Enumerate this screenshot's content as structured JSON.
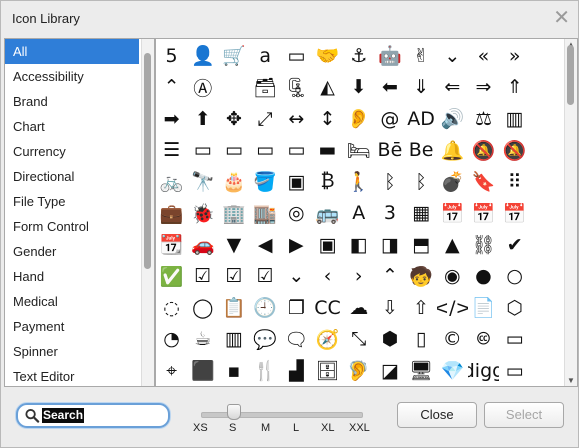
{
  "window": {
    "title": "Icon Library",
    "close_symbol": "✕"
  },
  "categories": [
    {
      "label": "All",
      "active": true
    },
    {
      "label": "Accessibility"
    },
    {
      "label": "Brand"
    },
    {
      "label": "Chart"
    },
    {
      "label": "Currency"
    },
    {
      "label": "Directional"
    },
    {
      "label": "File Type"
    },
    {
      "label": "Form Control"
    },
    {
      "label": "Gender"
    },
    {
      "label": "Hand"
    },
    {
      "label": "Medical"
    },
    {
      "label": "Payment"
    },
    {
      "label": "Spinner"
    },
    {
      "label": "Text Editor"
    }
  ],
  "icons": [
    [
      {
        "n": "html5-icon",
        "g": "5"
      },
      {
        "n": "user-plus-icon",
        "g": "👤"
      },
      {
        "n": "cart-plus-icon",
        "g": "🛒"
      },
      {
        "n": "amazon-icon",
        "g": "a"
      },
      {
        "n": "credit-card-alt-icon",
        "g": "▭"
      },
      {
        "n": "handshake-icon",
        "g": "🤝"
      },
      {
        "n": "anchor-icon",
        "g": "⚓"
      },
      {
        "n": "android-icon",
        "g": "🤖"
      },
      {
        "n": "peace-hand-icon",
        "g": "✌"
      },
      {
        "n": "angle-double-down-icon",
        "g": "⌄"
      },
      {
        "n": "angle-double-left-icon",
        "g": "«"
      },
      {
        "n": "angle-double-right-icon",
        "g": "»"
      }
    ],
    [
      {
        "n": "angle-double-up-icon",
        "g": "⌃"
      },
      {
        "n": "app-store-icon",
        "g": "Ⓐ"
      },
      {
        "n": "apple-icon",
        "g": ""
      },
      {
        "n": "archive-icon",
        "g": "🗃"
      },
      {
        "n": "file-archive-icon",
        "g": "🗜"
      },
      {
        "n": "area-chart-icon",
        "g": "◭"
      },
      {
        "n": "arrow-circle-down-icon",
        "g": "⬇"
      },
      {
        "n": "arrow-circle-left-icon",
        "g": "⬅"
      },
      {
        "n": "arrow-circle-o-down-icon",
        "g": "⇓"
      },
      {
        "n": "arrow-circle-o-left-icon",
        "g": "⇐"
      },
      {
        "n": "arrow-circle-o-right-icon",
        "g": "⇒"
      },
      {
        "n": "arrow-circle-o-up-icon",
        "g": "⇑"
      }
    ],
    [
      {
        "n": "arrow-circle-right-icon",
        "g": "➡"
      },
      {
        "n": "arrow-circle-up-icon",
        "g": "⬆"
      },
      {
        "n": "arrows-icon",
        "g": "✥"
      },
      {
        "n": "arrows-alt-icon",
        "g": "⤢"
      },
      {
        "n": "arrows-h-icon",
        "g": "↔"
      },
      {
        "n": "arrows-v-icon",
        "g": "↕"
      },
      {
        "n": "deaf-icon",
        "g": "👂"
      },
      {
        "n": "at-icon",
        "g": "@"
      },
      {
        "n": "audio-description-icon",
        "g": "AD"
      },
      {
        "n": "file-audio-icon",
        "g": "🔊"
      },
      {
        "n": "balance-scale-icon",
        "g": "⚖"
      },
      {
        "n": "bar-chart-icon",
        "g": "▥"
      }
    ],
    [
      {
        "n": "bars-icon",
        "g": "☰"
      },
      {
        "n": "battery-empty-icon",
        "g": "▭"
      },
      {
        "n": "battery-quarter-icon",
        "g": "▭"
      },
      {
        "n": "battery-half-icon",
        "g": "▭"
      },
      {
        "n": "battery-three-quarters-icon",
        "g": "▭"
      },
      {
        "n": "battery-full-icon",
        "g": "▬"
      },
      {
        "n": "bed-icon",
        "g": "🛏"
      },
      {
        "n": "behance-icon",
        "g": "Bē"
      },
      {
        "n": "behance-square-icon",
        "g": "Be"
      },
      {
        "n": "bell-icon",
        "g": "🔔"
      },
      {
        "n": "bell-slash-icon",
        "g": "🔕"
      },
      {
        "n": "bell-slash-o-icon",
        "g": "🔕"
      }
    ],
    [
      {
        "n": "bicycle-icon",
        "g": "🚲"
      },
      {
        "n": "binoculars-icon",
        "g": "🔭"
      },
      {
        "n": "birthday-cake-icon",
        "g": "🎂"
      },
      {
        "n": "bitbucket-icon",
        "g": "🪣"
      },
      {
        "n": "bitbucket-square-icon",
        "g": "▣"
      },
      {
        "n": "bitcoin-icon",
        "g": "₿"
      },
      {
        "n": "blind-icon",
        "g": "🚶"
      },
      {
        "n": "bluetooth-b-icon",
        "g": "ᛒ"
      },
      {
        "n": "bluetooth-icon",
        "g": "ᛒ"
      },
      {
        "n": "bomb-icon",
        "g": "💣"
      },
      {
        "n": "bookmark-o-icon",
        "g": "🔖"
      },
      {
        "n": "braille-icon",
        "g": "⠿"
      }
    ],
    [
      {
        "n": "briefcase-icon",
        "g": "💼"
      },
      {
        "n": "bug-icon",
        "g": "🐞"
      },
      {
        "n": "building-icon",
        "g": "🏢"
      },
      {
        "n": "building-o-icon",
        "g": "🏬"
      },
      {
        "n": "bullseye-icon",
        "g": "◎"
      },
      {
        "n": "bus-icon",
        "g": "🚌"
      },
      {
        "n": "buysellads-icon",
        "g": "A"
      },
      {
        "n": "css3-icon",
        "g": "3"
      },
      {
        "n": "calculator-icon",
        "g": "▦"
      },
      {
        "n": "calendar-check-icon",
        "g": "📅"
      },
      {
        "n": "calendar-minus-icon",
        "g": "📅"
      },
      {
        "n": "calendar-plus-icon",
        "g": "📅"
      }
    ],
    [
      {
        "n": "calendar-times-icon",
        "g": "📆"
      },
      {
        "n": "car-icon",
        "g": "🚗"
      },
      {
        "n": "caret-down-icon",
        "g": "▼"
      },
      {
        "n": "caret-left-icon",
        "g": "◀"
      },
      {
        "n": "caret-right-icon",
        "g": "▶"
      },
      {
        "n": "caret-square-down-icon",
        "g": "▣"
      },
      {
        "n": "caret-square-left-icon",
        "g": "◧"
      },
      {
        "n": "caret-square-right-icon",
        "g": "◨"
      },
      {
        "n": "caret-square-up-icon",
        "g": "⬒"
      },
      {
        "n": "caret-up-icon",
        "g": "▲"
      },
      {
        "n": "chain-broken-icon",
        "g": "⛓"
      },
      {
        "n": "check-icon",
        "g": "✔"
      }
    ],
    [
      {
        "n": "check-circle-icon",
        "g": "✅"
      },
      {
        "n": "check-circle-o-icon",
        "g": "☑"
      },
      {
        "n": "check-square-icon",
        "g": "☑"
      },
      {
        "n": "check-square-o-icon",
        "g": "☑"
      },
      {
        "n": "chevron-circle-down-icon",
        "g": "⌄"
      },
      {
        "n": "chevron-circle-left-icon",
        "g": "‹"
      },
      {
        "n": "chevron-circle-right-icon",
        "g": "›"
      },
      {
        "n": "chevron-circle-up-icon",
        "g": "⌃"
      },
      {
        "n": "child-icon",
        "g": "🧒"
      },
      {
        "n": "chrome-icon",
        "g": "◉"
      },
      {
        "n": "circle-icon",
        "g": "●"
      },
      {
        "n": "circle-o-icon",
        "g": "○"
      }
    ],
    [
      {
        "n": "circle-o-notch-icon",
        "g": "◌"
      },
      {
        "n": "circle-thin-icon",
        "g": "◯"
      },
      {
        "n": "clipboard-icon",
        "g": "📋"
      },
      {
        "n": "clock-icon",
        "g": "🕘"
      },
      {
        "n": "clone-icon",
        "g": "❐"
      },
      {
        "n": "cc-icon",
        "g": "CC"
      },
      {
        "n": "cloud-icon",
        "g": "☁"
      },
      {
        "n": "cloud-download-icon",
        "g": "⇩"
      },
      {
        "n": "cloud-upload-icon",
        "g": "⇧"
      },
      {
        "n": "code-icon",
        "g": "</>"
      },
      {
        "n": "file-code-icon",
        "g": "📄"
      },
      {
        "n": "codepen-icon",
        "g": "⬡"
      }
    ],
    [
      {
        "n": "codiepie-icon",
        "g": "◔"
      },
      {
        "n": "coffee-icon",
        "g": "☕"
      },
      {
        "n": "columns-icon",
        "g": "▥"
      },
      {
        "n": "comment-dots-icon",
        "g": "💬"
      },
      {
        "n": "commenting-o-icon",
        "g": "🗨"
      },
      {
        "n": "compass-icon",
        "g": "🧭"
      },
      {
        "n": "compress-icon",
        "g": "⤡"
      },
      {
        "n": "connectdevelop-icon",
        "g": "⬢"
      },
      {
        "n": "contao-icon",
        "g": "▯"
      },
      {
        "n": "copyright-icon",
        "g": "©"
      },
      {
        "n": "creative-commons-icon",
        "g": "🅭"
      },
      {
        "n": "credit-card-icon",
        "g": "▭"
      }
    ],
    [
      {
        "n": "crosshairs-icon",
        "g": "⌖"
      },
      {
        "n": "cube-icon",
        "g": "⬛"
      },
      {
        "n": "cubes-icon",
        "g": "▪"
      },
      {
        "n": "cutlery-icon",
        "g": "🍴"
      },
      {
        "n": "dashcube-icon",
        "g": "▟"
      },
      {
        "n": "database-icon",
        "g": "🗄"
      },
      {
        "n": "deafness-icon",
        "g": "🦻"
      },
      {
        "n": "delicious-icon",
        "g": "◪"
      },
      {
        "n": "desktop-icon",
        "g": "🖥"
      },
      {
        "n": "diamond-icon",
        "g": "💎"
      },
      {
        "n": "digg-icon",
        "g": "digg"
      },
      {
        "n": "dollar-card-icon",
        "g": "▭"
      }
    ]
  ],
  "search": {
    "value": "Search"
  },
  "sizes": [
    "XS",
    "S",
    "M",
    "L",
    "XL",
    "XXL"
  ],
  "size_level": 0.2,
  "buttons": {
    "close": "Close",
    "select": "Select"
  }
}
